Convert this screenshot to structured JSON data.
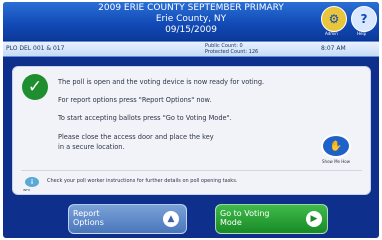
{
  "header": {
    "line1": "2009 ERIE COUNTY SEPTEMBER PRIMARY",
    "line2": "Erie County, NY",
    "line3": "09/15/2009",
    "admin_label": "Admin",
    "help_label": "Help"
  },
  "status": {
    "precinct": "PLO DEL 001 & 017",
    "public_count": "Public Count: 0",
    "protected_count": "Protected Count: 126",
    "time": "8:07 AM"
  },
  "message": {
    "line1": "The poll is open and the voting device is now ready for voting.",
    "line2": "For report options press \"Report Options\" now.",
    "line3": "To start accepting ballots press \"Go to Voting Mode\".",
    "line4": "Please close the access door and place the key",
    "line5": "in a secure location.",
    "show_me_how": "Show Me How"
  },
  "info": {
    "icon_label": "i",
    "icon_caption": "INFO",
    "text": "Check your poll worker instructions for further details on poll opening tasks."
  },
  "buttons": {
    "report_line1": "Report",
    "report_line2": "Options",
    "voting_line1": "Go to Voting",
    "voting_line2": "Mode"
  }
}
